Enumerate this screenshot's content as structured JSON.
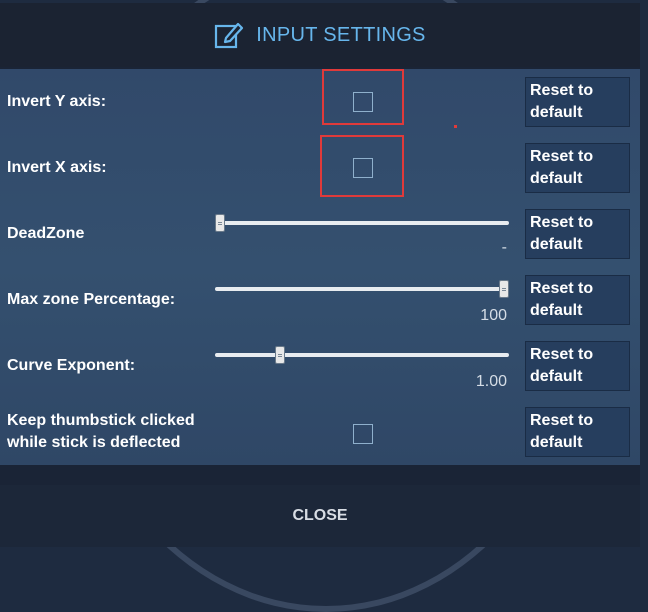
{
  "header": {
    "title": "INPUT SETTINGS",
    "icon": "edit-icon"
  },
  "settings": [
    {
      "label": "Invert Y axis:",
      "control": "checkbox",
      "checked": false,
      "reset": "Reset to\ndefault"
    },
    {
      "label": "Invert X axis:",
      "control": "checkbox",
      "checked": false,
      "reset": "Reset to\ndefault"
    },
    {
      "label": "DeadZone",
      "control": "slider",
      "value_text": "-",
      "slider_value": 0,
      "reset": "Reset to\ndefault"
    },
    {
      "label": "Max zone Percentage:",
      "control": "slider",
      "value_text": "100",
      "slider_value": 1.0,
      "reset": "Reset to\ndefault"
    },
    {
      "label": "Curve Exponent:",
      "control": "slider",
      "value_text": "1.00",
      "slider_value": 0.21,
      "reset": "Reset to\ndefault"
    },
    {
      "label": "Keep thumbstick clicked\nwhile stick is deflected",
      "control": "checkbox",
      "checked": false,
      "reset": "Reset to\ndefault"
    }
  ],
  "footer": {
    "close_label": "CLOSE"
  },
  "colors": {
    "accent": "#67b6ec",
    "highlight": "#e03a3a",
    "panel": "#34506f",
    "header": "#1b2332"
  }
}
